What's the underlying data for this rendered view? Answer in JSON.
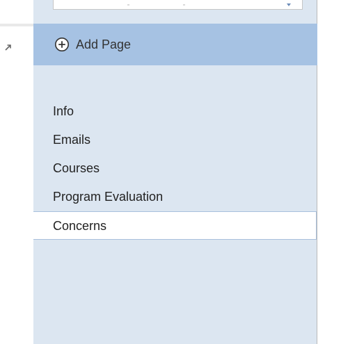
{
  "pane": {
    "add_page_label": "Add Page",
    "add_icon": "plus-circle-icon",
    "expand_icon": "expand-arrow-icon",
    "combo_arrow_icon": "chevron-down-icon"
  },
  "pages": [
    {
      "label": "Info",
      "selected": false
    },
    {
      "label": "Emails",
      "selected": false
    },
    {
      "label": "Courses",
      "selected": false
    },
    {
      "label": "Program Evaluation",
      "selected": false
    },
    {
      "label": "Concerns",
      "selected": true
    }
  ],
  "colors": {
    "pane_background": "#dce6f1",
    "add_page_background": "#a6c2e3",
    "selected_background": "#ffffff"
  }
}
